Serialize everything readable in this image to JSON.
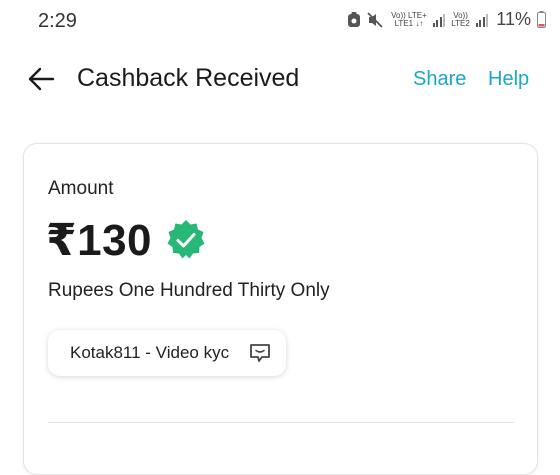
{
  "status_bar": {
    "time": "2:29",
    "sim1_top": "Vo)) LTE+",
    "sim1_bottom": "LTE1 ↓↑",
    "sim2_top": "Vo))",
    "sim2_bottom": "LTE2",
    "battery": "11%",
    "icons": [
      "battery-saver-icon",
      "mute-icon",
      "signal-icon",
      "battery-icon"
    ]
  },
  "header": {
    "title": "Cashback Received",
    "share_label": "Share",
    "help_label": "Help",
    "accent_color": "#1aa7c9"
  },
  "card": {
    "amount_label": "Amount",
    "amount_value": "₹130",
    "amount_words": "Rupees One Hundred Thirty Only",
    "verified_color": "#27b777",
    "note": "Kotak811 - Video kyc"
  }
}
